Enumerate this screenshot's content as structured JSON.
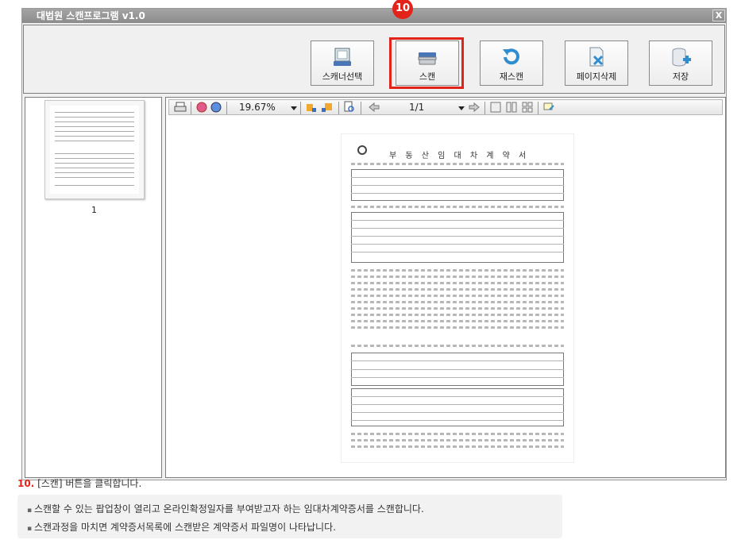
{
  "window": {
    "title": "대법원 스캔프로그램 v1.0",
    "close_label": "X"
  },
  "step_badge": "10",
  "toolbar": {
    "buttons": [
      {
        "label": "스캐너선택",
        "icon": "scanner-icon"
      },
      {
        "label": "스캔",
        "icon": "scan-icon"
      },
      {
        "label": "재스캔",
        "icon": "rescan-icon"
      },
      {
        "label": "페이지삭제",
        "icon": "delete-page-icon"
      },
      {
        "label": "저장",
        "icon": "save-icon"
      }
    ]
  },
  "thumbnails": [
    {
      "number": "1"
    }
  ],
  "viewer": {
    "zoom": "19.67%",
    "page": "1/1"
  },
  "document": {
    "title": "부 동 산 임 대 차 계 약 서"
  },
  "instruction": {
    "step": "10.",
    "text": " [스캔] 버튼을 클릭합니다."
  },
  "notes": [
    "스캔할 수 있는 팝업창이 열리고 온라인확정일자를 부여받고자 하는 임대차계약증서를 스캔합니다.",
    "스캔과정을 마치면 계약증서목록에 스캔받은 계약증서 파일명이 나타납니다."
  ],
  "colors": {
    "accent": "#e2231a",
    "title_bar": "#999999"
  }
}
